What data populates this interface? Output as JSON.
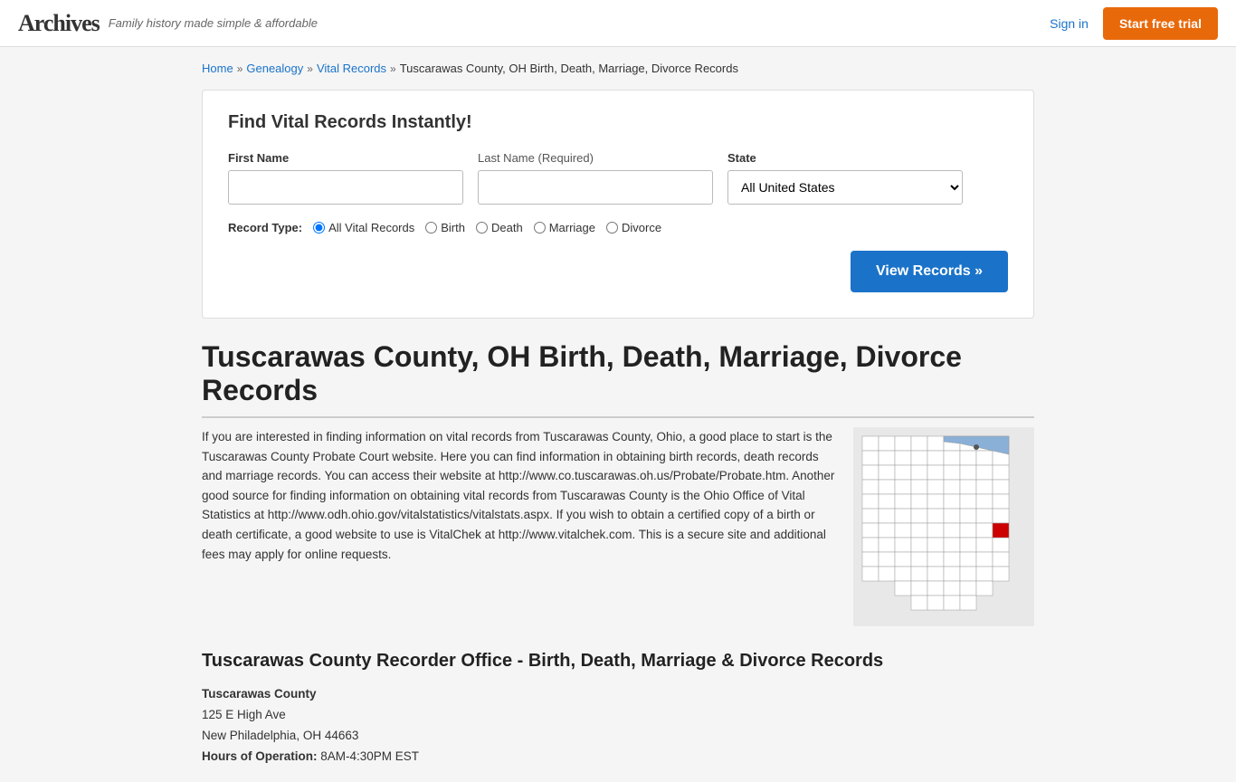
{
  "header": {
    "logo": "Archives",
    "tagline": "Family history made simple & affordable",
    "signin_label": "Sign in",
    "trial_label": "Start free trial"
  },
  "breadcrumb": {
    "home": "Home",
    "genealogy": "Genealogy",
    "vital_records": "Vital Records",
    "current": "Tuscarawas County, OH Birth, Death, Marriage, Divorce Records"
  },
  "search": {
    "title": "Find Vital Records Instantly!",
    "first_name_label": "First Name",
    "last_name_label": "Last Name",
    "last_name_required": "(Required)",
    "state_label": "State",
    "state_default": "All United States",
    "record_type_label": "Record Type:",
    "record_types": [
      {
        "id": "all",
        "label": "All Vital Records",
        "checked": true
      },
      {
        "id": "birth",
        "label": "Birth",
        "checked": false
      },
      {
        "id": "death",
        "label": "Death",
        "checked": false
      },
      {
        "id": "marriage",
        "label": "Marriage",
        "checked": false
      },
      {
        "id": "divorce",
        "label": "Divorce",
        "checked": false
      }
    ],
    "view_records_btn": "View Records »"
  },
  "page": {
    "title": "Tuscarawas County, OH Birth, Death, Marriage, Divorce Records",
    "intro": "If you are interested in finding information on vital records from Tuscarawas County, Ohio, a good place to start is the Tuscarawas County Probate Court website. Here you can find information in obtaining birth records, death records and marriage records. You can access their website at http://www.co.tuscarawas.oh.us/Probate/Probate.htm. Another good source for finding information on obtaining vital records from Tuscarawas County is the Ohio Office of Vital Statistics at http://www.odh.ohio.gov/vitalstatistics/vitalstats.aspx. If you wish to obtain a certified copy of a birth or death certificate, a good website to use is VitalChek at http://www.vitalchek.com. This is a secure site and additional fees may apply for online requests.",
    "recorder_title": "Tuscarawas County Recorder Office - Birth, Death, Marriage & Divorce Records",
    "county_name": "Tuscarawas County",
    "address_line1": "125 E High Ave",
    "address_line2": "New Philadelphia, OH 44663",
    "hours_label": "Hours of Operation:",
    "hours": "8AM-4:30PM EST"
  }
}
